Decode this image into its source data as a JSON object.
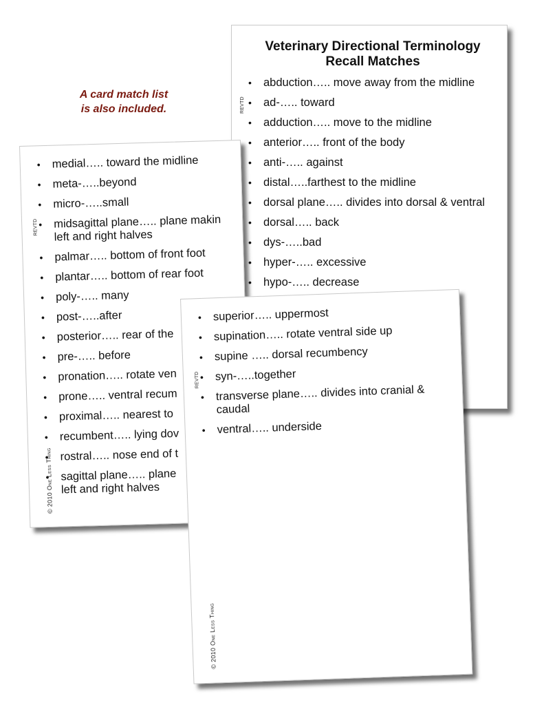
{
  "promo_note": {
    "line1": "A card match list",
    "line2": "is also included.",
    "color": "#7a1a10"
  },
  "cards": {
    "back": {
      "title_line1": "Veterinary Directional Terminology",
      "title_line2": "Recall Matches",
      "revtd": "REVTD",
      "items": [
        {
          "text": "abduction….. move away from the midline"
        },
        {
          "text": "ad-….. toward"
        },
        {
          "text": "adduction….. move to the midline"
        },
        {
          "text": "anterior….. front of the body"
        },
        {
          "text": "anti-….. against"
        },
        {
          "text": "distal…..farthest to the midline"
        },
        {
          "text": "dorsal plane….. divides into dorsal & ventral"
        },
        {
          "text": "dorsal….. back"
        },
        {
          "text": "dys-…..bad"
        },
        {
          "text": "hyper-….. excessive"
        },
        {
          "text": "hypo-….. decrease"
        }
      ]
    },
    "left": {
      "revtd": "REVTD",
      "copyright": "© 2010 One Less Thing",
      "items": [
        {
          "text": "medial….. toward the midline"
        },
        {
          "text": "meta-…..beyond"
        },
        {
          "text": "micro-…..small"
        },
        {
          "text": "midsagittal plane….. plane makin",
          "text2": "left and right halves"
        },
        {
          "text": "palmar….. bottom of front foot"
        },
        {
          "text": "plantar….. bottom of rear foot"
        },
        {
          "text": "poly-….. many"
        },
        {
          "text": "post-…..after"
        },
        {
          "text": "posterior….. rear of the"
        },
        {
          "text": "pre-….. before"
        },
        {
          "text": "pronation….. rotate ven"
        },
        {
          "text": "prone….. ventral recum"
        },
        {
          "text": "proximal….. nearest to"
        },
        {
          "text": "recumbent….. lying dov"
        },
        {
          "text": "rostral….. nose end of t"
        },
        {
          "text": "sagittal plane….. plane",
          "text2": "left and right halves"
        }
      ]
    },
    "front": {
      "revtd": "REVTD",
      "copyright": "© 2010 One Less Thing",
      "items": [
        {
          "text": "superior….. uppermost"
        },
        {
          "text": "supination….. rotate ventral side up"
        },
        {
          "text": "supine ….. dorsal recumbency"
        },
        {
          "text": "syn-…..together"
        },
        {
          "text": "transverse plane….. divides into cranial & caudal"
        },
        {
          "text": "ventral….. underside"
        }
      ]
    }
  }
}
